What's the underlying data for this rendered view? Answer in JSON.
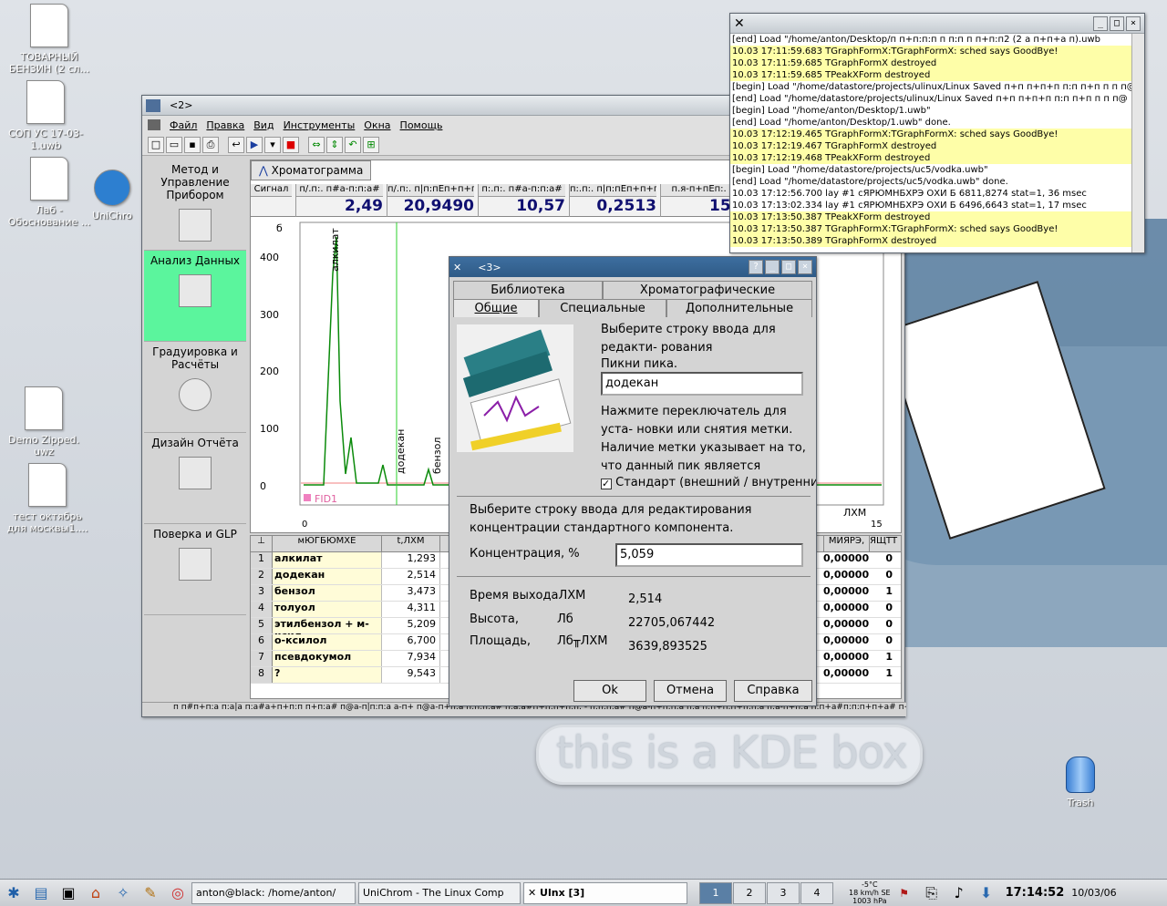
{
  "desktop": {
    "icons": [
      {
        "label": "ТОВАРНЫЙ БЕНЗИН (2 сл..."
      },
      {
        "label": "СОП УС 17-03-1.uwb"
      },
      {
        "label": "Лаб - Обоснование ..."
      },
      {
        "label": "UniChro"
      },
      {
        "label": "Demo Zipped. uwz"
      },
      {
        "label": "тест октябрь для москвы1...."
      }
    ],
    "kde_box": "this is a KDE box",
    "trash_label": "Trash"
  },
  "main_window": {
    "title": "<2>",
    "menu": [
      "Файл",
      "Правка",
      "Вид",
      "Инструменты",
      "Окна",
      "Помощь"
    ],
    "sidebar": [
      {
        "label": "Метод и Управление Прибором"
      },
      {
        "label": "Анализ Данных"
      },
      {
        "label": "Градуировка и Расчёты"
      },
      {
        "label": "Дизайн Отчёта"
      },
      {
        "label": "Поверка и GLP"
      }
    ],
    "chart_tab": "Хроматограмма",
    "signal_label": "Сигнал",
    "signal_headers": [
      "п/.п:. п#а-п:п:а#",
      "п/.п:. п|п:пЁп+п+п:",
      "п:.п:. п#а-п:п:а#",
      "п:.п:. п|п:пЁп+п+п:",
      "п.я-п+пЁп:. ф"
    ],
    "signal_values": [
      "2,49",
      "20,9490",
      "10,57",
      "0,2513",
      "15,0"
    ],
    "y_axis_unit": "б",
    "y_ticks": [
      "400",
      "300",
      "200",
      "100",
      "0"
    ],
    "x_axis_unit": "ЛХМ",
    "x_start": "0",
    "x_end": "15",
    "peak_labels": [
      "алкилат",
      "додекан",
      "бензол"
    ],
    "trace_label": "FID1",
    "table_headers": [
      "мЮГБЮМХЕ",
      "t,ЛХМ",
      "МИЯРЭ,",
      "ЯЩТТ"
    ],
    "table_rows": [
      {
        "n": "1",
        "name": "алкилат",
        "t": "1,293",
        "c": "0,00000",
        "d": "0"
      },
      {
        "n": "2",
        "name": "додекан",
        "t": "2,514",
        "c": "0,00000",
        "d": "0"
      },
      {
        "n": "3",
        "name": "бензол",
        "t": "3,473",
        "c": "0,00000",
        "d": "1"
      },
      {
        "n": "4",
        "name": "толуол",
        "t": "4,311",
        "c": "0,00000",
        "d": "0"
      },
      {
        "n": "5",
        "name": "этилбензол + м-ксил",
        "t": "5,209",
        "c": "0,00000",
        "d": "0"
      },
      {
        "n": "6",
        "name": "о-ксилол",
        "t": "6,700",
        "c": "0,00000",
        "d": "0"
      },
      {
        "n": "7",
        "name": "псевдокумол",
        "t": "7,934",
        "c": "0,00000",
        "d": "1"
      },
      {
        "n": "8",
        "name": "?",
        "t": "9,543",
        "c": "0,00000",
        "d": "1"
      }
    ],
    "status_text": "п п#п+п:а п:а|а п:а#а+п+п:п п+п:а# п@а-п|п:п:а а-п+ п@а-п+п:а п:п:п:а# п:а:а#п+п:п+п:п: - п:п:п:а# п@а-п+п:п:а п:а п:п+п:п+п:п:а п:а-п+п:а п:п+а#п:п:п+п+а# п+а-п:а"
  },
  "log_window": {
    "lines": [
      {
        "text": "[end] Load \"/home/anton/Desktop/п п+п:п:п п п:п п п+п:п2 (2 а п+п+а п).uwb",
        "y": false
      },
      {
        "text": "10.03 17:11:59.683 TGraphFormX:TGraphFormX: sched says GoodBye!",
        "y": true
      },
      {
        "text": "10.03 17:11:59.685 TGraphFormX destroyed",
        "y": true
      },
      {
        "text": "10.03 17:11:59.685 TPeakXForm destroyed",
        "y": true
      },
      {
        "text": "[begin] Load \"/home/datastore/projects/ulinux/Linux Saved п+п п+п+п п:п п+п п п п@",
        "y": false
      },
      {
        "text": "[end] Load \"/home/datastore/projects/ulinux/Linux Saved п+п п+п+п п:п п+п п п п@",
        "y": false
      },
      {
        "text": "[begin] Load \"/home/anton/Desktop/1.uwb\"",
        "y": false
      },
      {
        "text": "[end] Load \"/home/anton/Desktop/1.uwb\" done.",
        "y": false
      },
      {
        "text": "10.03 17:12:19.465 TGraphFormX:TGraphFormX: sched says GoodBye!",
        "y": true
      },
      {
        "text": "10.03 17:12:19.467 TGraphFormX destroyed",
        "y": true
      },
      {
        "text": "10.03 17:12:19.468 TPeakXForm destroyed",
        "y": true
      },
      {
        "text": "[begin] Load \"/home/datastore/projects/uc5/vodka.uwb\"",
        "y": false
      },
      {
        "text": "[end] Load \"/home/datastore/projects/uc5/vodka.uwb\" done.",
        "y": false
      },
      {
        "text": "10.03 17:12:56.700 lay #1 сЯРЮМНБХРЭ ОХИ Б 6811,8274 stat=1, 36 msec",
        "y": false
      },
      {
        "text": "10.03 17:13:02.334 lay #1 сЯРЮМНБХРЭ ОХИ Б 6496,6643 stat=1, 17 msec",
        "y": false
      },
      {
        "text": "10.03 17:13:50.387 TPeakXForm destroyed",
        "y": true
      },
      {
        "text": "10.03 17:13:50.387 TGraphFormX:TGraphFormX: sched says GoodBye!",
        "y": true
      },
      {
        "text": "10.03 17:13:50.389 TGraphFormX destroyed",
        "y": true
      }
    ]
  },
  "dialog": {
    "title": "<3>",
    "tabs_top": [
      "Библиотека",
      "Хроматографические"
    ],
    "tabs_bottom": [
      "Общие",
      "Специальные",
      "Дополнительные"
    ],
    "hint1": "Выберите строку ввода для редакти- рования",
    "peak_name_label": "Пикни пика.",
    "peak_name_value": "додекан",
    "hint2": "Нажмите переключатель для уста- новки или снятия метки. Наличие метки указывает на то, что данный пик является",
    "standard_checkbox": "Стандарт (внешний / внутренни",
    "hint3": "Выберите строку ввода для редактирования концентрации стандартного компонента.",
    "conc_label": "Концентрация,  %",
    "conc_value": "5,059",
    "rt_label": "Время выходаЛХМ",
    "rt_value": "2,514",
    "height_label": "Высота,",
    "height_unit": "Лб",
    "height_value": "22705,067442",
    "area_label": "Площадь,",
    "area_unit": "Лб╥ЛХМ",
    "area_value": "3639,893525",
    "ok": "Ok",
    "cancel": "Отмена",
    "help": "Справка"
  },
  "taskbar": {
    "tasks": [
      "anton@black: /home/anton/",
      "UniChrom - The Linux Comp",
      "Ulnx [3]"
    ],
    "pager": [
      "1",
      "2",
      "3",
      "4"
    ],
    "weather_temp": "-5°C",
    "weather_wind": "18 km/h SE",
    "weather_pressure": "1003 hPa",
    "time": "17:14:52",
    "date": "10/03/06"
  }
}
